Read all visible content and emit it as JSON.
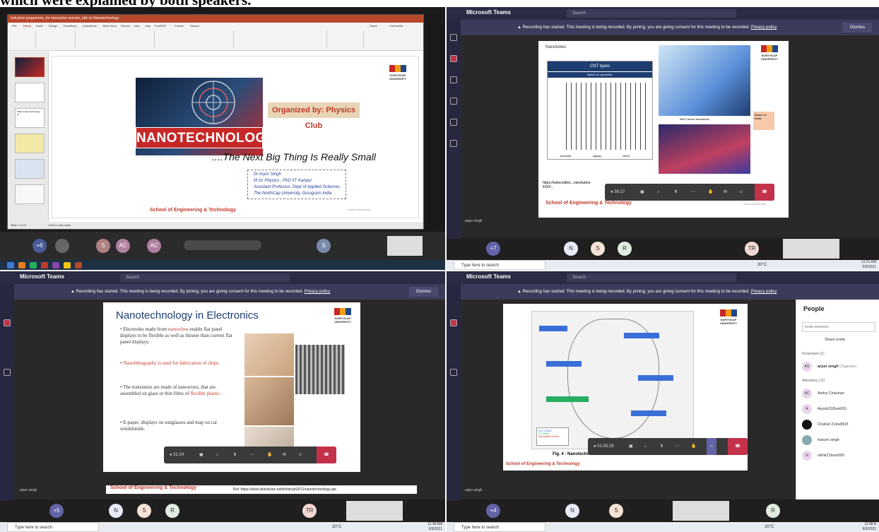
{
  "caption": "which were explained by both speakers.",
  "ppt": {
    "window_title": "Induction programme_for interactive session_talk on Nanotechnology",
    "tabs": [
      "File",
      "Home",
      "Insert",
      "Design",
      "Transitions",
      "Animations",
      "Slide Show",
      "Review",
      "View",
      "Help",
      "FoxitPDF",
      "Format",
      "Search"
    ],
    "share": "Share",
    "comments": "Comments",
    "banner": "NANOTECHNOLOGY",
    "organized": "Organized by: Physics Club",
    "tagline": "....The Next Big Thing Is Really Small",
    "author_lines": [
      "Dr Arjun Singh",
      "M.Sc Physics , PhD  IIT Kanpur",
      "Assistant Professor ,Dept of Applied Sciences",
      "The NorthCap University, Gurugram India"
    ],
    "school": "School of Engineering & Technology",
    "website": "www.ncuindia.edu",
    "notes": "Click to add notes",
    "status": "Slide 1 of 24",
    "logo": "NORTHCAP UNIVERSITY",
    "thumb_label": "What is Nanotechnology...(t)",
    "bottom_avatars": [
      "+6",
      "S",
      "AC",
      "AC",
      "S"
    ]
  },
  "teams": {
    "app": "Microsoft Teams",
    "search": "Search",
    "recording_msg": "Recording has started. This meeting is being recorded. By joining, you are giving consent for this meeting to be recorded.",
    "privacy": "Privacy policy",
    "dismiss": "Dismiss",
    "presenter_name": "arjun singh",
    "windows_search": "Type here to search",
    "temp": "30°C",
    "lang": "ENG US",
    "logo": "NORTHCAP UNIVERSITY",
    "school": "School of Engineering & Technology",
    "website": "www.ncuindia.edu",
    "q2": {
      "slide_title": "Nanotubes",
      "cnt_title": "CNT types",
      "cnt_sub": "Based on symmetry",
      "cnt_labels": [
        "armchair",
        "zigzag",
        "chiral"
      ],
      "mw_label": "MW Carbon Nanotubes",
      "based": "Based on Walls",
      "url": "https://www.slides...nanotubes-4164...",
      "timer": "38:17",
      "clock_time": "11:21 AM",
      "clock_date": "9/9/2021",
      "avatars": [
        "+7",
        "N",
        "S",
        "R",
        "TR"
      ]
    },
    "q3": {
      "slide_title": "Nanotechnology in Electronics",
      "b1_pre": "Electrodes made from ",
      "b1_red": "nanowires",
      "b1_post": " enable flat panel displays to be flexible as well as thinner than current flat panel displays.",
      "b2_red": "Nanolithography is used for fabrication of chips.",
      "b3_pre": "The transistors are made of nanowires, that are assembled on glass or thin films of ",
      "b3_red": "flexible plastic.",
      "b4": "E-paper, displays on sunglasses and map on car windshields.",
      "ref": "Ref: https://www.slideshare.net/kirtisingh2011/nanotechnology-ppt",
      "timer": "51:24",
      "clock_time": "11:34 AM",
      "clock_date": "9/9/2021",
      "avatars": [
        "+5",
        "N",
        "S",
        "R",
        "TR"
      ]
    },
    "q4": {
      "fig_caption": "Fig. 4 : Nanotechn...",
      "legend": [
        "DST Centre",
        "IIT Centre",
        "Specialised Centre"
      ],
      "timer": "01:05:29",
      "clock_time": "11:48 A",
      "clock_date": "9/9/2021",
      "people_title": "People",
      "invite_placeholder": "Invite someone",
      "share_invite": "Share invite",
      "presenters_label": "Presenters (1)",
      "organizer_name": "arjun singh",
      "organizer_role": "Organizer",
      "attendees_label": "Attendees (11)",
      "attendees": [
        {
          "initials": "AC",
          "name": "Astha Chauhan"
        },
        {
          "initials": "A",
          "name": "Ayush21Bsm001"
        },
        {
          "initials": "",
          "name": "Chahat 21bsd003"
        },
        {
          "initials": "",
          "name": "hukum singh"
        },
        {
          "initials": "N",
          "name": "nikhil21bsm005"
        }
      ],
      "avatars": [
        "+4",
        "N",
        "S",
        "R"
      ]
    }
  },
  "colors": {
    "teams_bar": "#2b2b45",
    "record_bar": "#3b3b5a",
    "hangup": "#c4314b",
    "ppt_red": "#b7472a",
    "nano_red": "#c62828"
  }
}
